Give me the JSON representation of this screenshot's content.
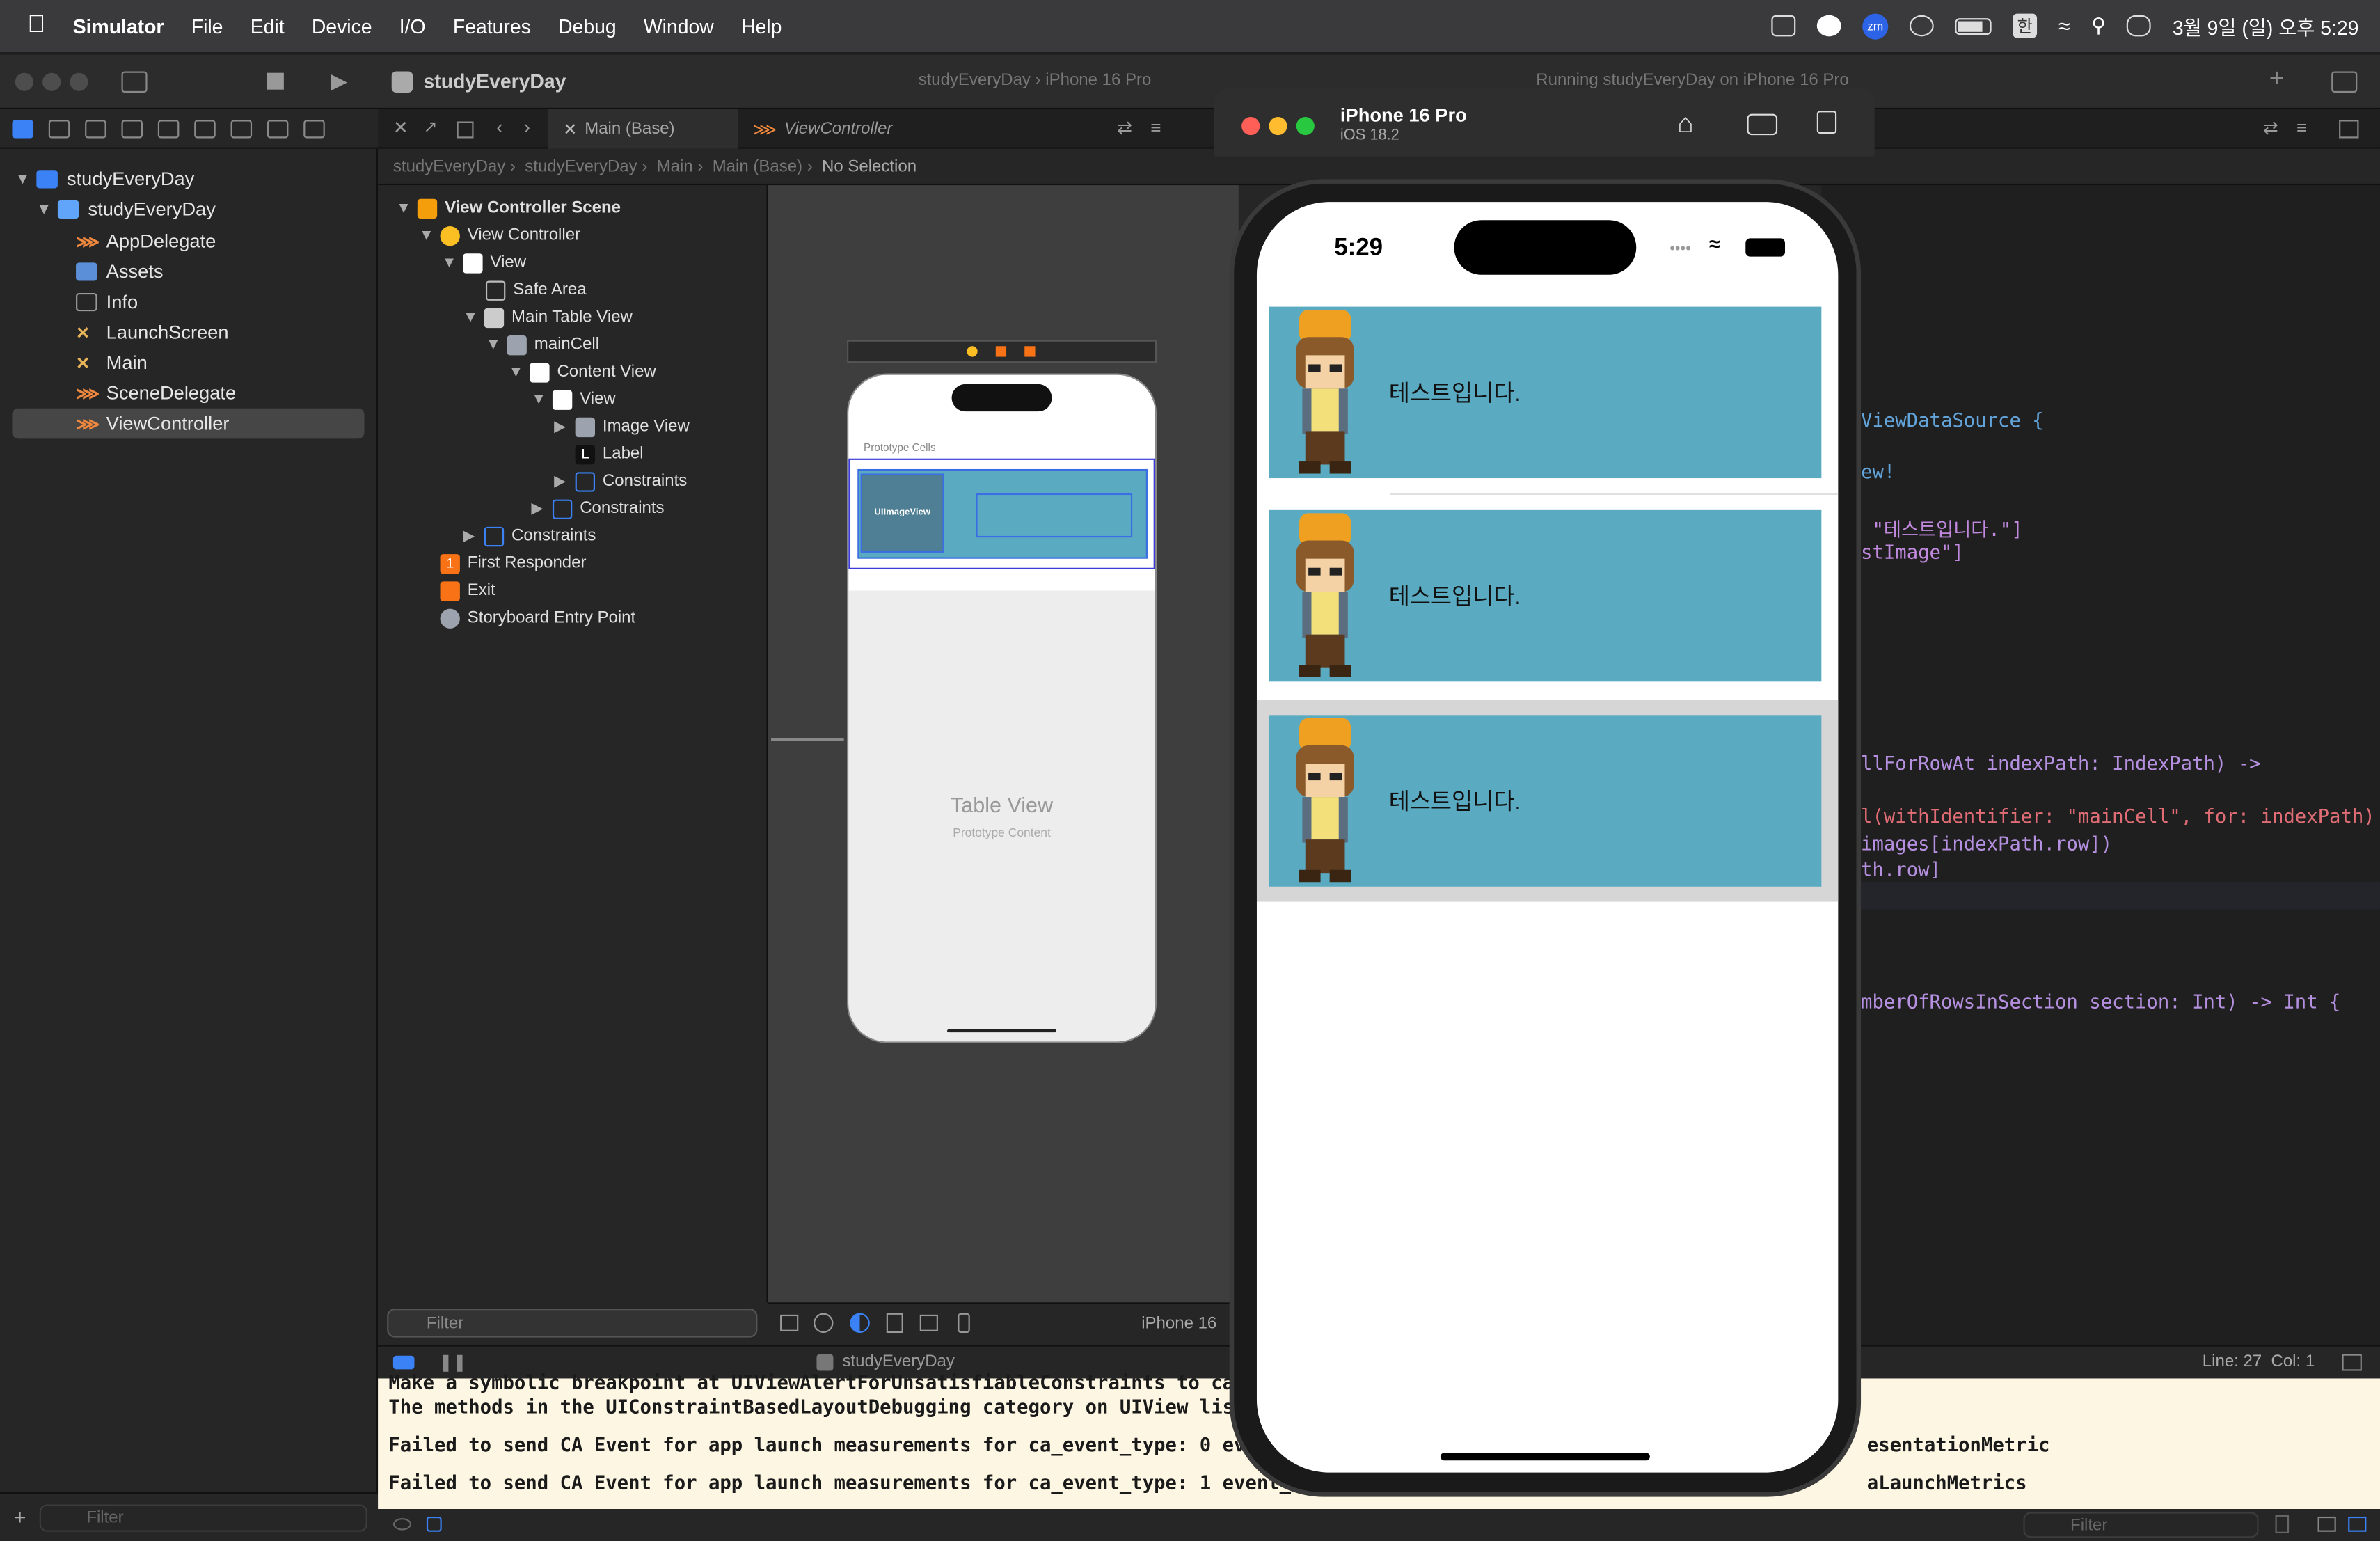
{
  "menubar": {
    "app": "Simulator",
    "items": [
      "File",
      "Edit",
      "Device",
      "I/O",
      "Features",
      "Debug",
      "Window",
      "Help"
    ],
    "clock": "3월 9일 (일) 오후 5:29",
    "input_lang": "한"
  },
  "toolbar": {
    "project": "studyEveryDay",
    "scheme_app": "studyEveryDay",
    "scheme_device": "iPhone 16 Pro",
    "status": "Running studyEveryDay on iPhone 16 Pro"
  },
  "navigator": {
    "project": "studyEveryDay",
    "group": "studyEveryDay",
    "files": [
      "AppDelegate",
      "Assets",
      "Info",
      "LaunchScreen",
      "Main",
      "SceneDelegate",
      "ViewController"
    ],
    "filter_placeholder": "Filter"
  },
  "tabs": {
    "main": "Main (Base)",
    "vc": "ViewController"
  },
  "jumpbar": [
    "studyEveryDay",
    "studyEveryDay",
    "Main",
    "Main (Base)",
    "No Selection"
  ],
  "outline": {
    "rows": [
      "View Controller Scene",
      "View Controller",
      "View",
      "Safe Area",
      "Main Table View",
      "mainCell",
      "Content View",
      "View",
      "Image View",
      "Label",
      "Constraints",
      "Constraints",
      "Constraints",
      "First Responder",
      "Exit",
      "Storyboard Entry Point"
    ],
    "label_badge": "L",
    "filter_placeholder": "Filter",
    "first_responder_badge": "1"
  },
  "canvas": {
    "prototype_cells": "Prototype Cells",
    "uiimageview": "UIImageView",
    "table_view": "Table View",
    "prototype_content": "Prototype Content",
    "device": "iPhone 16"
  },
  "simulator": {
    "device": "iPhone 16 Pro",
    "os": "iOS 18.2",
    "time": "5:29",
    "cell_text": "테스트입니다.",
    "cells": 3
  },
  "code": {
    "l1": "ViewDataSource {",
    "l2": "ew!",
    "l3": " \"테스트입니다.\"]",
    "l4": "stImage\"]",
    "l5": "llForRowAt indexPath: IndexPath) ->",
    "l6": "l(withIdentifier: \"mainCell\", for: indexPath)",
    "l7": "images[indexPath.row])",
    "l8": "th.row]",
    "l9": "mberOfRowsInSection section: Int) -> Int {",
    "position": "Line: 27  Col: 1"
  },
  "debug": {
    "target": "studyEveryDay"
  },
  "console": {
    "lines": [
      "Make a symbolic breakpoint at UIViewAlertForUnsatisfiableConstraints to cat",
      "The methods in the UIConstraintBasedLayoutDebugging category on UIView liste",
      "Failed to send CA Event for app launch measurements for ca_event_type: 0 even",
      "Failed to send CA Event for app launch measurements for ca_event_type: 1 event_na"
    ],
    "tail1": "esentationMetric",
    "tail2": "aLaunchMetrics",
    "filter_placeholder": "Filter"
  }
}
